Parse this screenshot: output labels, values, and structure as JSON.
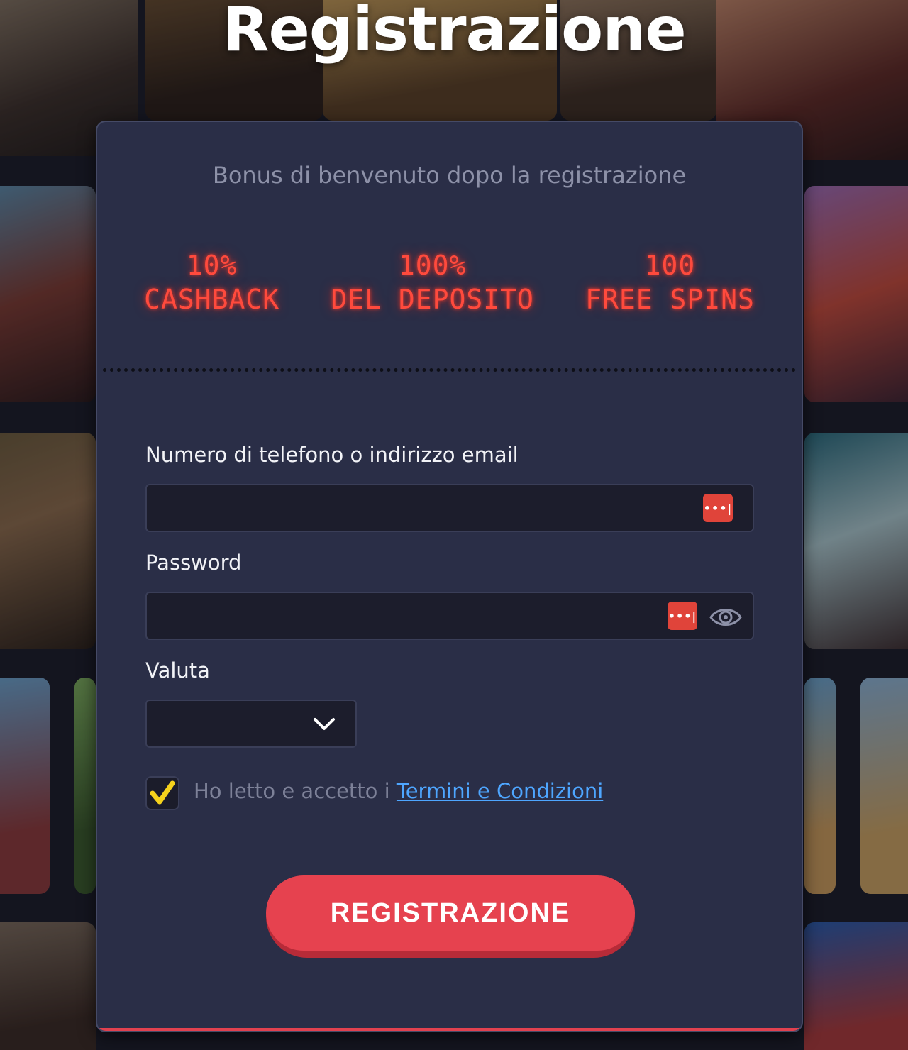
{
  "page": {
    "title": "Registrazione"
  },
  "bonus": {
    "intro": "Bonus di benvenuto dopo la registrazione",
    "offers": [
      {
        "line1": "10%",
        "line2": "CASHBACK"
      },
      {
        "line1": "100%",
        "line2": "DEL DEPOSITO"
      },
      {
        "line1": "100",
        "line2": "FREE SPINS"
      }
    ]
  },
  "form": {
    "login_label": "Numero di telefono o indirizzo email",
    "login_value": "",
    "password_label": "Password",
    "password_value": "",
    "password_manager_glyph": "•••|",
    "currency_label": "Valuta",
    "currency_value": "",
    "terms_checked": true,
    "terms_prefix": "Ho letto e accetto i ",
    "terms_link": "Termini e Condizioni",
    "submit_label": "REGISTRAZIONE"
  },
  "colors": {
    "card_bg": "#2a2e47",
    "accent_red": "#e6424f",
    "neon_red": "#ff4a3d",
    "check_yellow": "#f5d21c",
    "link_blue": "#4ea6ff"
  }
}
